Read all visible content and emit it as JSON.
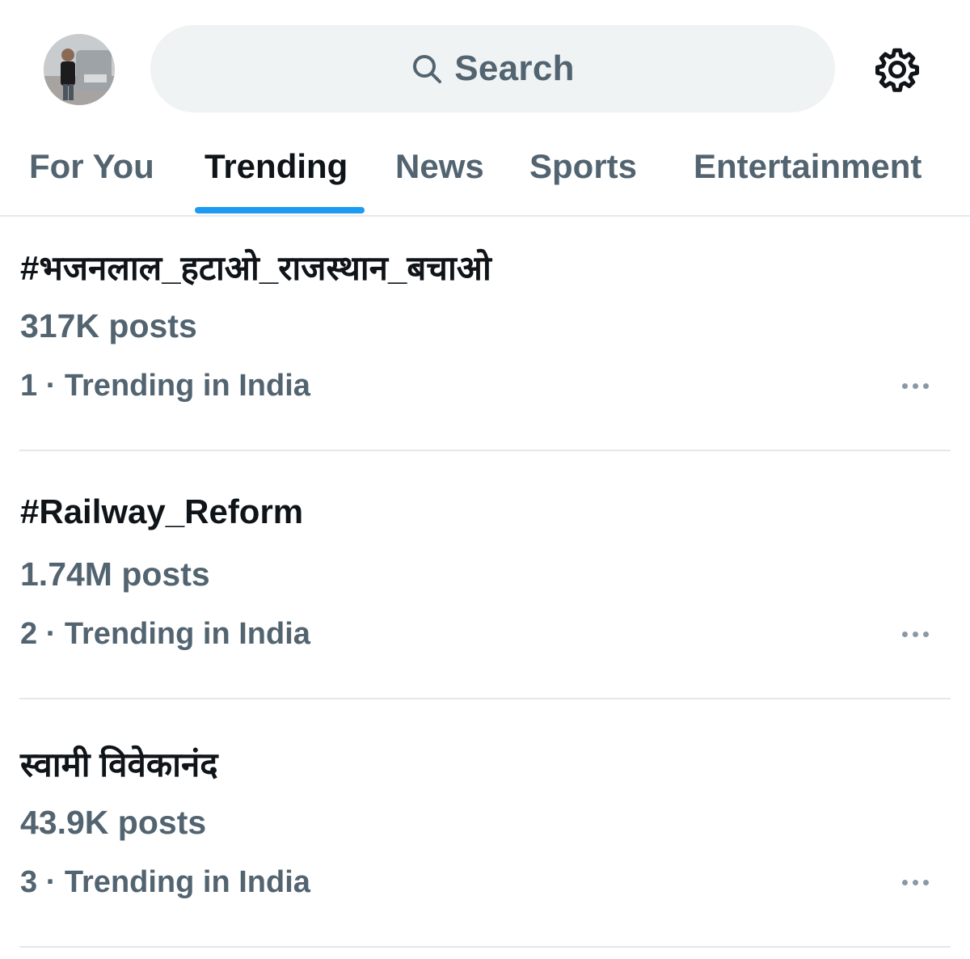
{
  "header": {
    "avatar_icon": "user-avatar-photo",
    "search_placeholder": "Search",
    "search_icon": "search-icon",
    "settings_icon": "gear-icon"
  },
  "tabs": [
    {
      "label": "For You",
      "active": false
    },
    {
      "label": "Trending",
      "active": true
    },
    {
      "label": "News",
      "active": false
    },
    {
      "label": "Sports",
      "active": false
    },
    {
      "label": "Entertainment",
      "active": false
    }
  ],
  "trends": [
    {
      "name": "#भजनलाल_हटाओ_राजस्थान_बचाओ",
      "posts": "317K posts",
      "meta": "1 · Trending in India"
    },
    {
      "name": "#Railway_Reform",
      "posts": "1.74M posts",
      "meta": "2 · Trending in India"
    },
    {
      "name": "स्वामी विवेकानंद",
      "posts": "43.9K posts",
      "meta": "3 · Trending in India"
    }
  ],
  "colors": {
    "accent": "#1d9bf0",
    "primary_text": "#0f1419",
    "secondary_text": "#536471",
    "search_bg": "#eff3f4",
    "divider": "#e4e7e9"
  }
}
